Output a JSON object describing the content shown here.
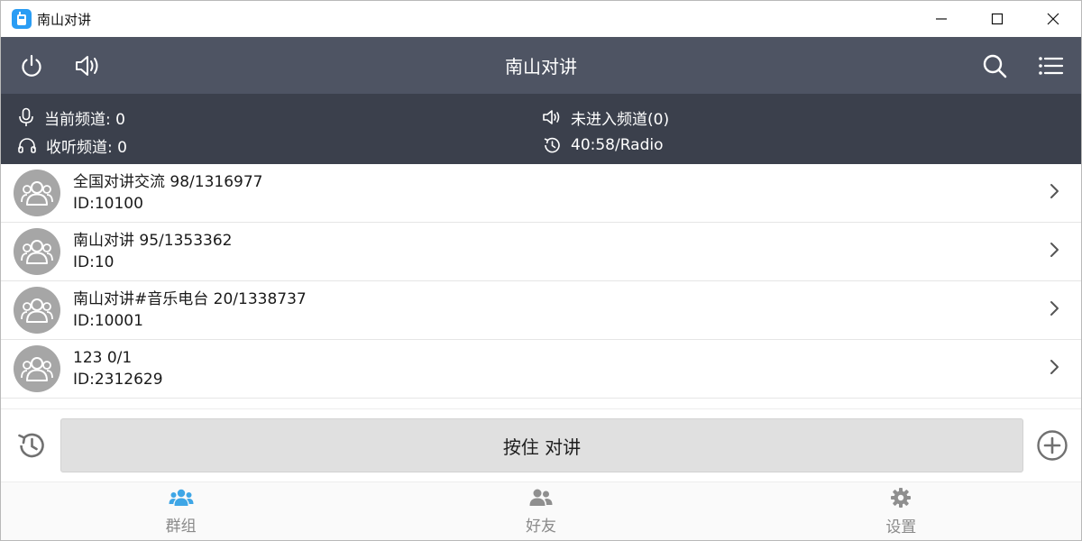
{
  "window": {
    "title": "南山对讲"
  },
  "header": {
    "title": "南山对讲",
    "icons": [
      "power-icon",
      "speaker-icon",
      "search-icon",
      "menu-list-icon"
    ]
  },
  "status": {
    "current_channel": "当前频道: 0",
    "listen_channel": "收听频道: 0",
    "not_entered": "未进入频道(0)",
    "timer": "40:58/Radio"
  },
  "groups": [
    {
      "name": "全国对讲交流 98/1316977",
      "id": "ID:10100"
    },
    {
      "name": "南山对讲 95/1353362",
      "id": "ID:10"
    },
    {
      "name": "南山对讲#音乐电台 20/1338737",
      "id": "ID:10001"
    },
    {
      "name": "123 0/1",
      "id": "ID:2312629"
    }
  ],
  "ptt": {
    "label": "按住 对讲"
  },
  "tabs": [
    {
      "label": "群组",
      "icon": "group-icon",
      "active": true
    },
    {
      "label": "好友",
      "icon": "friends-icon",
      "active": false
    },
    {
      "label": "设置",
      "icon": "gear-icon",
      "active": false
    }
  ],
  "colors": {
    "header_bg": "#4e5463",
    "status_bg": "#3b404c",
    "active_tab_icon": "#3ea6e6",
    "avatar_bg": "#a6a6a6"
  }
}
